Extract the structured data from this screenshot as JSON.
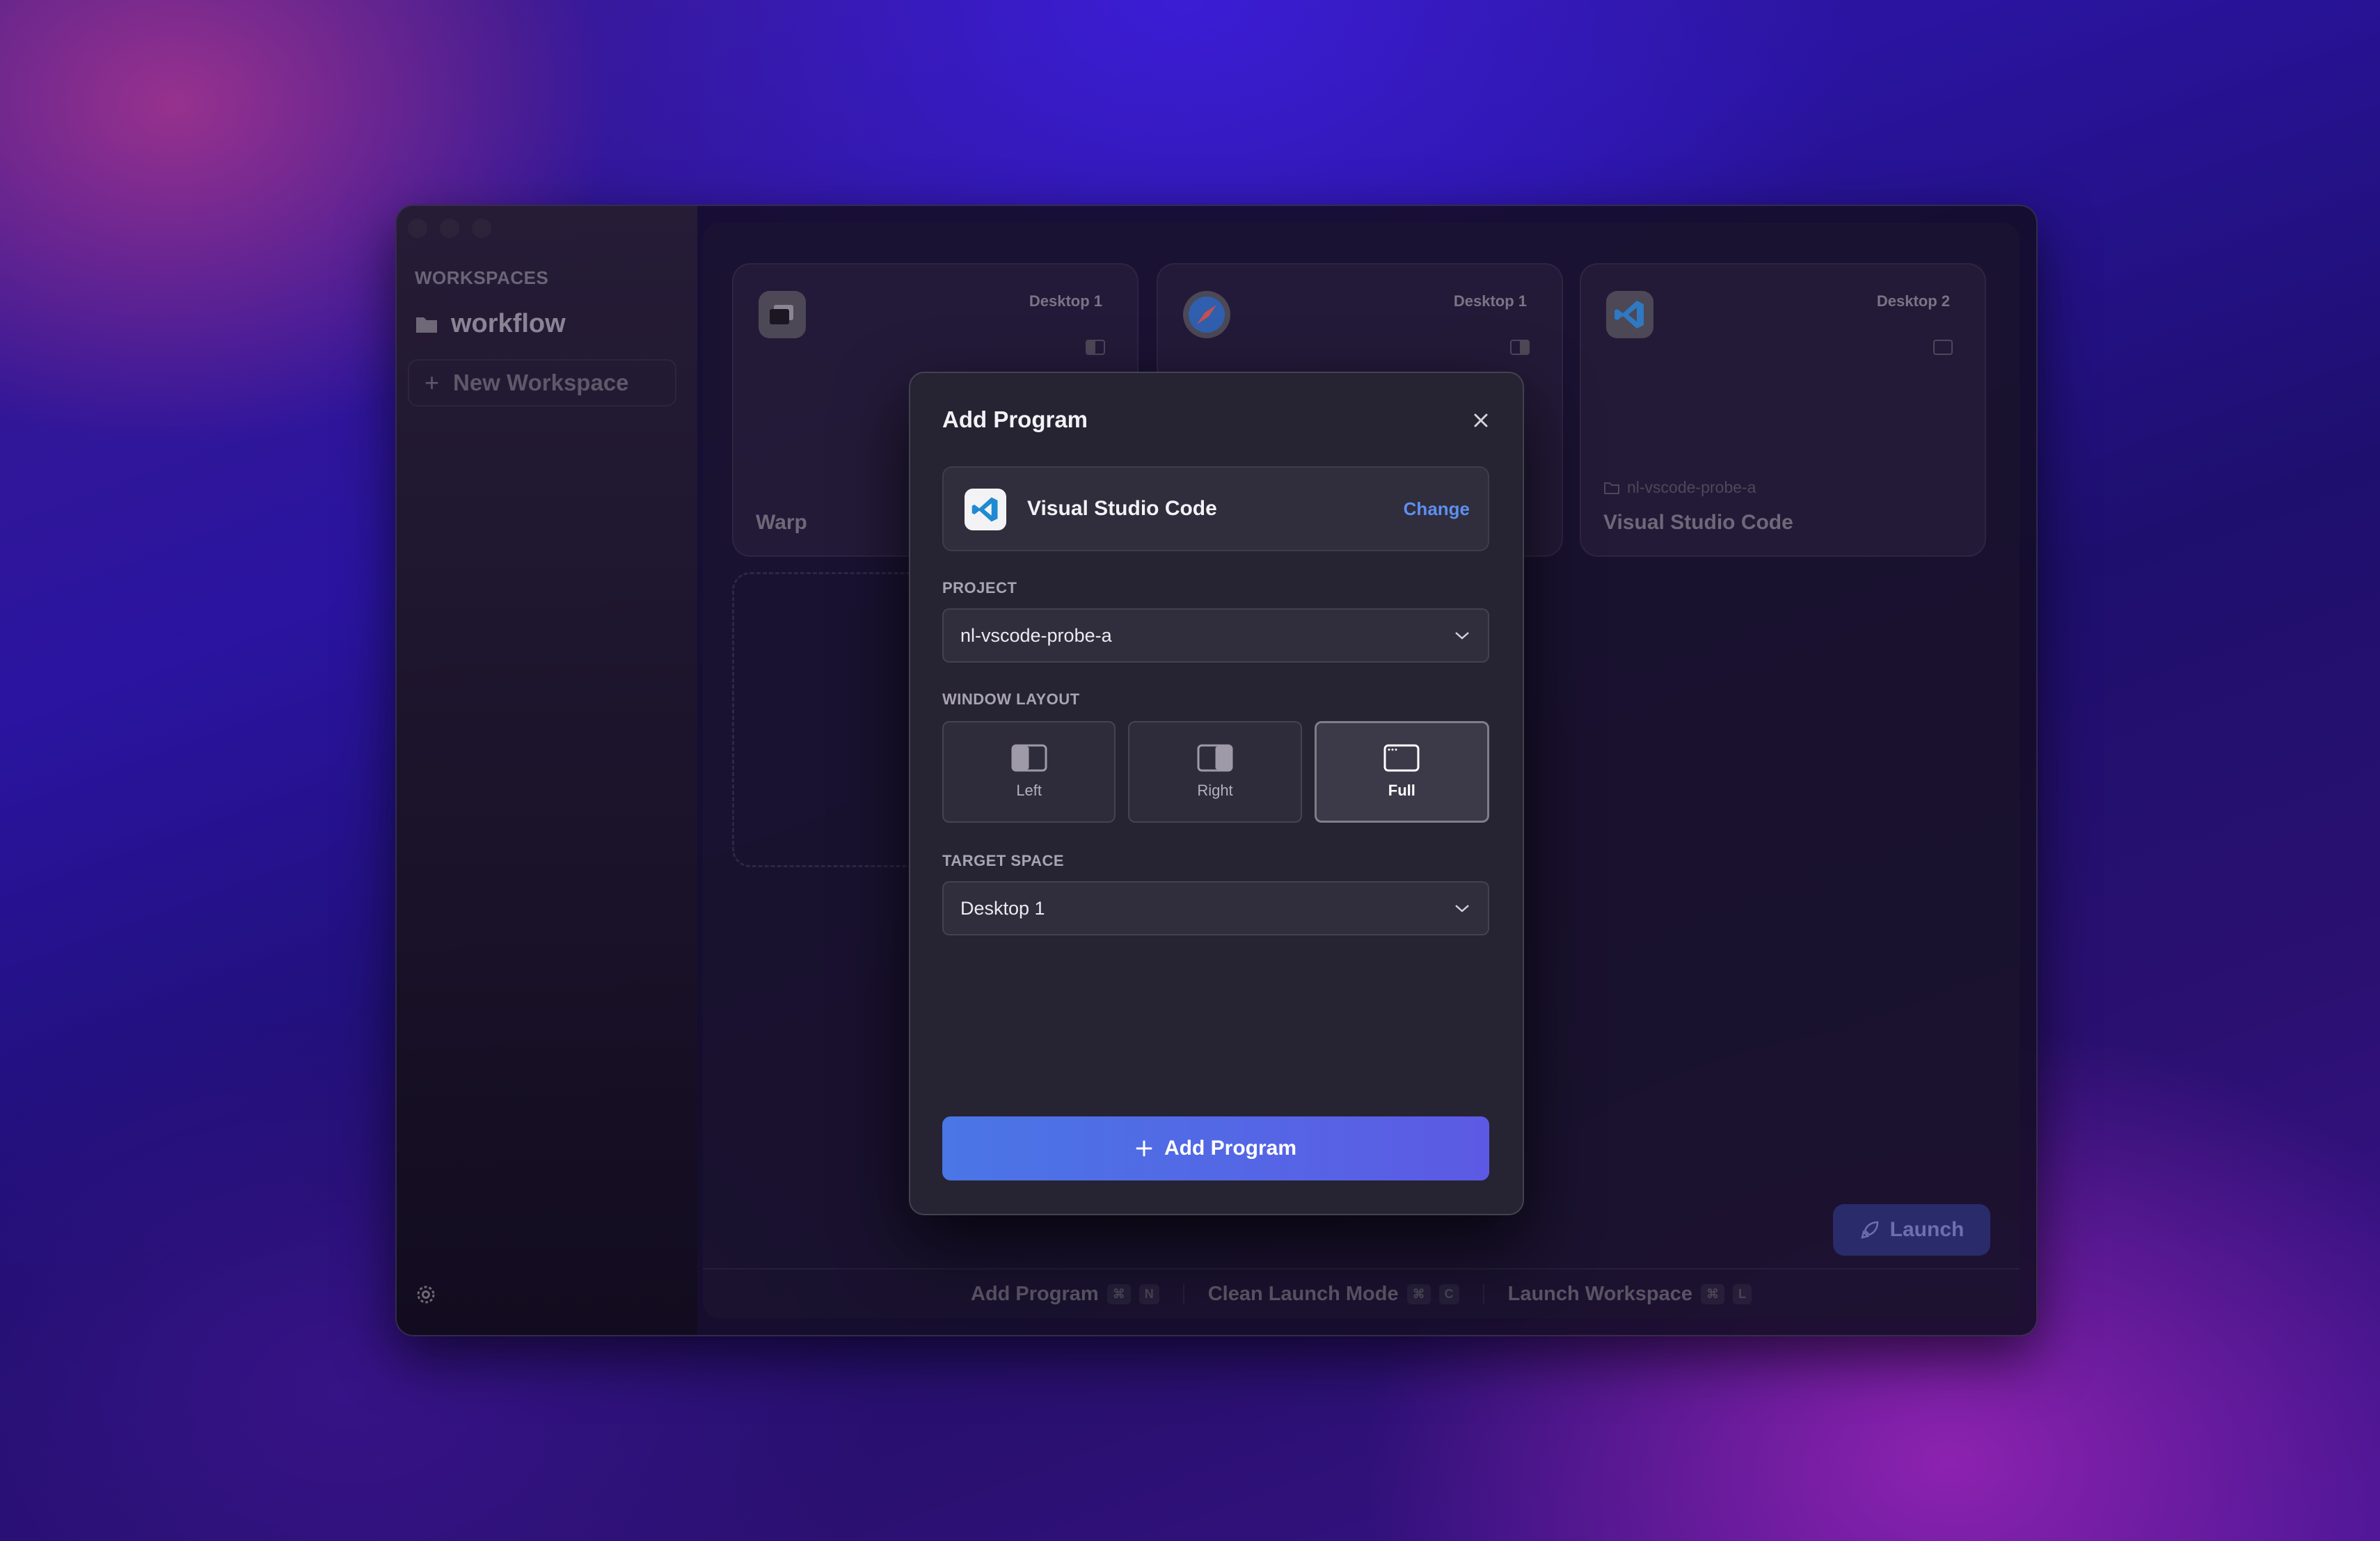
{
  "sidebar": {
    "section_header": "WORKSPACES",
    "workspaces": [
      {
        "name": "workflow",
        "icon": "folder-icon"
      }
    ],
    "new_workspace_label": "New Workspace",
    "settings_icon": "gear-icon"
  },
  "cards": [
    {
      "app": "Warp",
      "desktop": "Desktop 1",
      "icon": "warp-icon",
      "layout": "left"
    },
    {
      "app": "Safari",
      "desktop": "Desktop 1",
      "icon": "safari-icon",
      "layout": "right"
    },
    {
      "app": "Visual Studio Code",
      "desktop": "Desktop 2",
      "icon": "vscode-icon",
      "layout": "full",
      "path": "nl-vscode-probe-a"
    }
  ],
  "launch_button": "Launch",
  "shortcuts": [
    {
      "label": "Add Program",
      "keys": [
        "⌘",
        "N"
      ]
    },
    {
      "label": "Clean Launch Mode",
      "keys": [
        "⌘",
        "C"
      ]
    },
    {
      "label": "Launch Workspace",
      "keys": [
        "⌘",
        "L"
      ]
    }
  ],
  "modal": {
    "title": "Add Program",
    "selected_program": "Visual Studio Code",
    "change_label": "Change",
    "project_label": "PROJECT",
    "project_value": "nl-vscode-probe-a",
    "window_layout_label": "WINDOW LAYOUT",
    "layouts": [
      {
        "label": "Left",
        "selected": false
      },
      {
        "label": "Right",
        "selected": false
      },
      {
        "label": "Full",
        "selected": true
      }
    ],
    "target_space_label": "TARGET SPACE",
    "target_space_value": "Desktop 1",
    "submit_label": "Add Program"
  }
}
